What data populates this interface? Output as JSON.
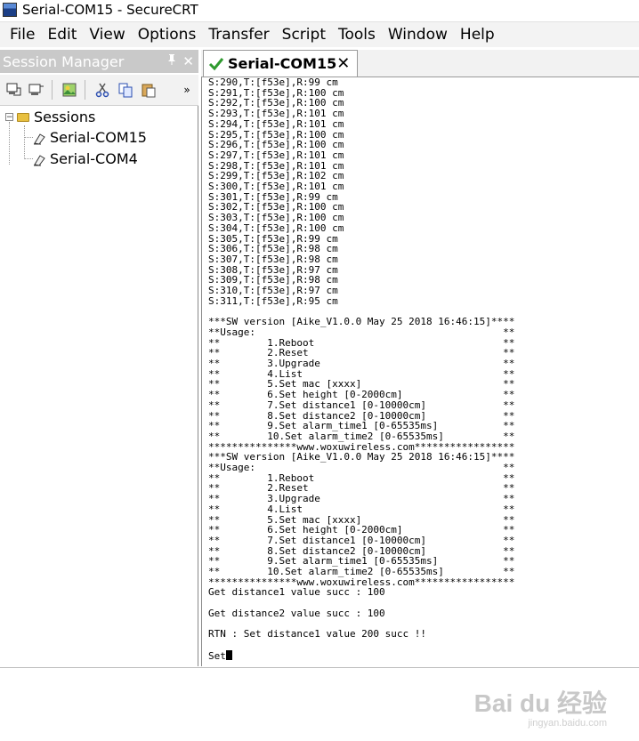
{
  "window": {
    "title": "Serial-COM15 - SecureCRT"
  },
  "menu": [
    "File",
    "Edit",
    "View",
    "Options",
    "Transfer",
    "Script",
    "Tools",
    "Window",
    "Help"
  ],
  "session_manager": {
    "title": "Session Manager",
    "pin_glyph": "4",
    "close_glyph": "✕",
    "tree": {
      "root": "Sessions",
      "items": [
        "Serial-COM15",
        "Serial-COM4"
      ]
    }
  },
  "tab": {
    "label": "Serial-COM15",
    "close_glyph": "✕"
  },
  "terminal": {
    "lines": [
      "S:290,T:[f53e],R:99 cm",
      "S:291,T:[f53e],R:100 cm",
      "S:292,T:[f53e],R:100 cm",
      "S:293,T:[f53e],R:101 cm",
      "S:294,T:[f53e],R:101 cm",
      "S:295,T:[f53e],R:100 cm",
      "S:296,T:[f53e],R:100 cm",
      "S:297,T:[f53e],R:101 cm",
      "S:298,T:[f53e],R:101 cm",
      "S:299,T:[f53e],R:102 cm",
      "S:300,T:[f53e],R:101 cm",
      "S:301,T:[f53e],R:99 cm",
      "S:302,T:[f53e],R:100 cm",
      "S:303,T:[f53e],R:100 cm",
      "S:304,T:[f53e],R:100 cm",
      "S:305,T:[f53e],R:99 cm",
      "S:306,T:[f53e],R:98 cm",
      "S:307,T:[f53e],R:98 cm",
      "S:308,T:[f53e],R:97 cm",
      "S:309,T:[f53e],R:98 cm",
      "S:310,T:[f53e],R:97 cm",
      "S:311,T:[f53e],R:95 cm",
      "",
      "***SW version [Aike_V1.0.0 May 25 2018 16:46:15]****",
      "**Usage:                                          **",
      "**        1.Reboot                                **",
      "**        2.Reset                                 **",
      "**        3.Upgrade                               **",
      "**        4.List                                  **",
      "**        5.Set mac [xxxx]                        **",
      "**        6.Set height [0-2000cm]                 **",
      "**        7.Set distance1 [0-10000cm]             **",
      "**        8.Set distance2 [0-10000cm]             **",
      "**        9.Set alarm_time1 [0-65535ms]           **",
      "**        10.Set alarm_time2 [0-65535ms]          **",
      "***************www.woxuwireless.com*****************",
      "***SW version [Aike_V1.0.0 May 25 2018 16:46:15]****",
      "**Usage:                                          **",
      "**        1.Reboot                                **",
      "**        2.Reset                                 **",
      "**        3.Upgrade                               **",
      "**        4.List                                  **",
      "**        5.Set mac [xxxx]                        **",
      "**        6.Set height [0-2000cm]                 **",
      "**        7.Set distance1 [0-10000cm]             **",
      "**        8.Set distance2 [0-10000cm]             **",
      "**        9.Set alarm_time1 [0-65535ms]           **",
      "**        10.Set alarm_time2 [0-65535ms]          **",
      "***************www.woxuwireless.com*****************",
      "Get distance1 value succ : 100",
      "",
      "Get distance2 value succ : 100",
      "",
      "RTN : Set distance1 value 200 succ !!",
      "",
      "Set"
    ]
  },
  "watermark": {
    "text": "Bai du 经验",
    "sub": "jingyan.baidu.com"
  }
}
